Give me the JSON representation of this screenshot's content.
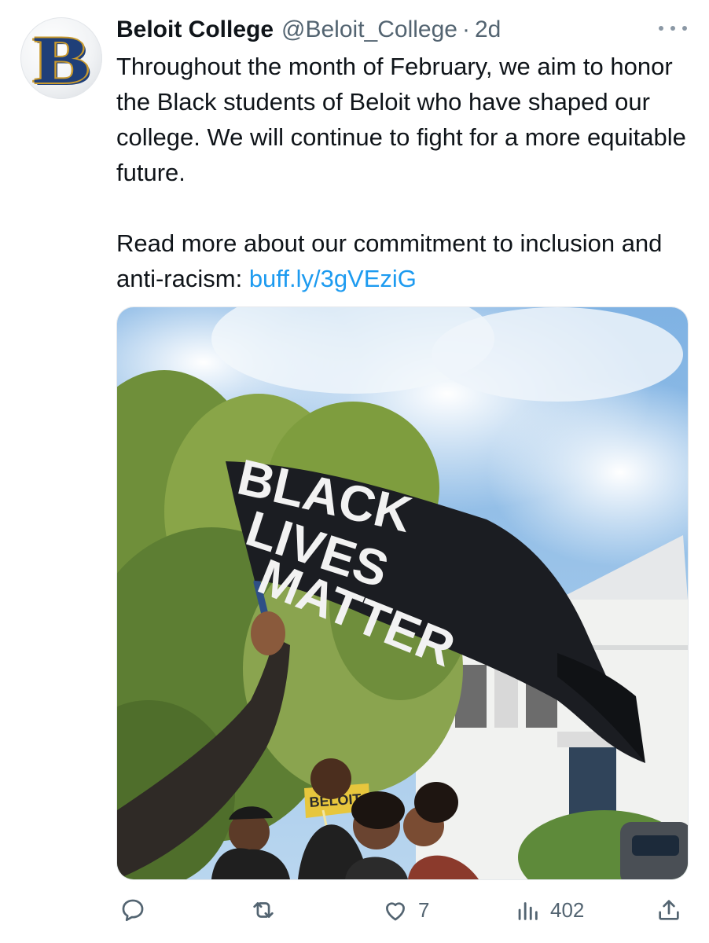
{
  "tweet": {
    "author_name": "Beloit College",
    "handle": "@Beloit_College",
    "separator": "·",
    "time": "2d",
    "avatar_letter": "B",
    "paragraph1": "Throughout the month of February, we aim to honor the Black students of Beloit who have shaped our college. We will continue to fight for a more equitable future.",
    "paragraph2_prefix": "Read more about our commitment to inclusion and anti-racism: ",
    "link_text": "buff.ly/3gVEziG",
    "media": {
      "flag_words": [
        "BLACK",
        "LIVES",
        "MATTER"
      ],
      "sign_text": "BELOIT"
    }
  },
  "actions": {
    "reply_count": "",
    "retweet_count": "",
    "like_count": "7",
    "views_count": "402"
  },
  "colors": {
    "link": "#1d9bf0",
    "secondary_text": "#536471",
    "brand_blue": "#1f3f78",
    "brand_gold": "#c99a2e"
  },
  "icons": [
    "more-icon",
    "reply-icon",
    "retweet-icon",
    "like-icon",
    "views-icon",
    "share-icon"
  ]
}
